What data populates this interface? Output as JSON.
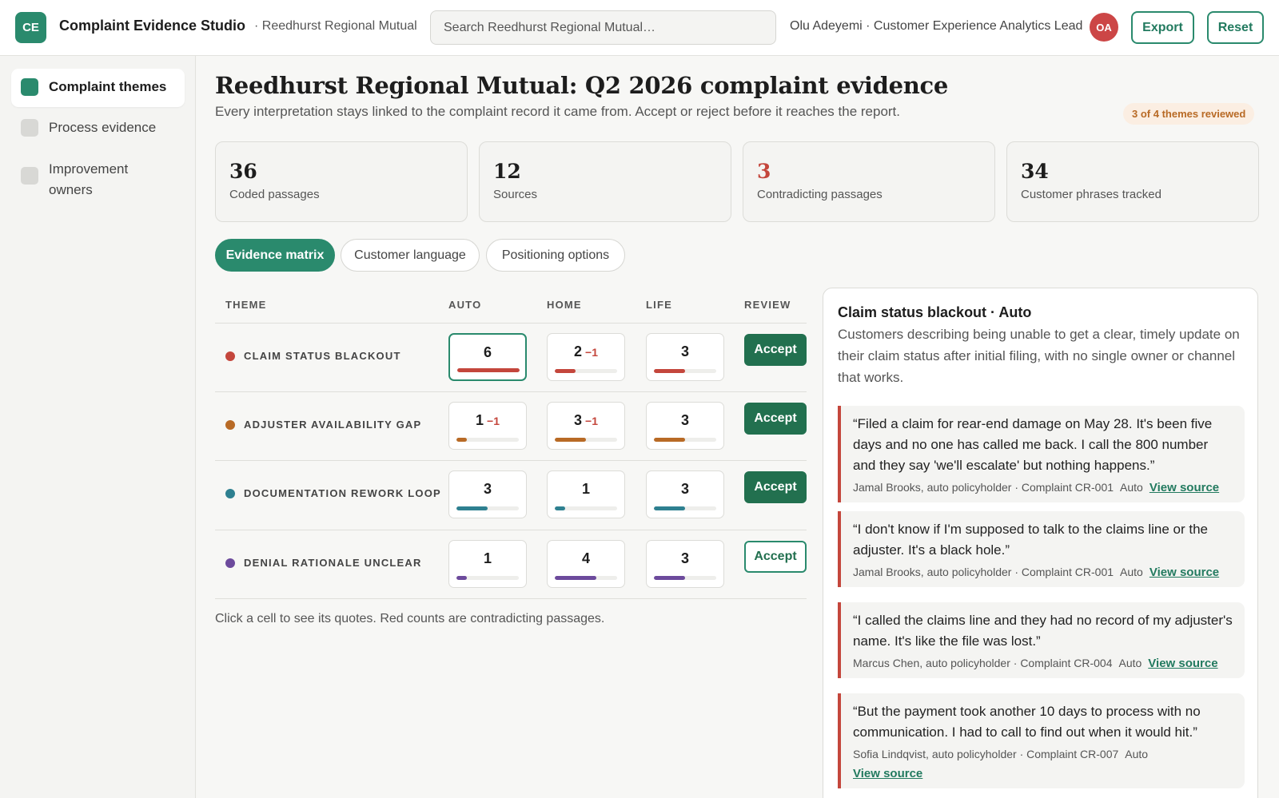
{
  "app": {
    "logo_initials": "CE",
    "title": "Complaint Evidence Studio",
    "org": "· Reedhurst Regional Mutual",
    "search_placeholder": "Search Reedhurst Regional Mutual…",
    "user": "Olu Adeyemi · Customer Experience Analytics Lead",
    "avatar_initials": "OA",
    "export_label": "Export",
    "reset_label": "Reset"
  },
  "sidebar": {
    "items": [
      {
        "label": "Complaint themes",
        "active": true
      },
      {
        "label": "Process evidence",
        "active": false
      },
      {
        "label": "Improvement owners",
        "active": false
      }
    ]
  },
  "main": {
    "title": "Reedhurst Regional Mutual: Q2 2026 complaint evidence",
    "subtitle": "Every interpretation stays linked to the complaint record it came from. Accept or reject before it reaches the report.",
    "review_badge": "3 of 4 themes reviewed",
    "stats": [
      {
        "value": "36",
        "label": "Coded passages"
      },
      {
        "value": "12",
        "label": "Sources"
      },
      {
        "value": "3",
        "label": "Contradicting passages"
      },
      {
        "value": "34",
        "label": "Customer phrases tracked"
      }
    ],
    "tabs": [
      {
        "label": "Evidence matrix"
      },
      {
        "label": "Customer language"
      },
      {
        "label": "Positioning options"
      }
    ]
  },
  "matrix": {
    "headers": [
      "THEME",
      "AUTO",
      "HOME",
      "LIFE",
      "REVIEW"
    ],
    "bar_max": 6,
    "rows": [
      {
        "theme": "CLAIM STATUS BLACKOUT",
        "color": "#c4463c",
        "cells": [
          {
            "count": "6",
            "contradict": "",
            "fill": 6
          },
          {
            "count": "2",
            "contradict": "−1",
            "fill": 2
          },
          {
            "count": "3",
            "contradict": "",
            "fill": 3
          }
        ],
        "accept": "Accept",
        "accepted": true
      },
      {
        "theme": "ADJUSTER AVAILABILITY GAP",
        "color": "#b86a25",
        "cells": [
          {
            "count": "1",
            "contradict": "−1",
            "fill": 1
          },
          {
            "count": "3",
            "contradict": "−1",
            "fill": 3
          },
          {
            "count": "3",
            "contradict": "",
            "fill": 3
          }
        ],
        "accept": "Accept",
        "accepted": true
      },
      {
        "theme": "DOCUMENTATION REWORK LOOP",
        "color": "#2e8090",
        "cells": [
          {
            "count": "3",
            "contradict": "",
            "fill": 3
          },
          {
            "count": "1",
            "contradict": "",
            "fill": 1
          },
          {
            "count": "3",
            "contradict": "",
            "fill": 3
          }
        ],
        "accept": "Accept",
        "accepted": true
      },
      {
        "theme": "DENIAL RATIONALE UNCLEAR",
        "color": "#6c4a9c",
        "cells": [
          {
            "count": "1",
            "contradict": "",
            "fill": 1
          },
          {
            "count": "4",
            "contradict": "",
            "fill": 4
          },
          {
            "count": "3",
            "contradict": "",
            "fill": 3
          }
        ],
        "accept": "Accept",
        "accepted": false
      }
    ],
    "note": "Click a cell to see its quotes. Red counts are contradicting passages."
  },
  "panel": {
    "title": "Claim status blackout · Auto",
    "description": "Customers describing being unable to get a clear, timely update on their claim status after initial filing, with no single owner or channel that works.",
    "quotes": [
      {
        "text": "“Filed a claim for rear-end damage on May 28. It's been five days and no one has called me back. I call the 800 number and they say 'we'll escalate' but nothing happens.”",
        "source": "Jamal Brooks, auto policyholder · Complaint CR-001",
        "line": "Auto",
        "link": "View source"
      },
      {
        "text": "“I don't know if I'm supposed to talk to the claims line or the adjuster. It's a black hole.”",
        "source": "Jamal Brooks, auto policyholder · Complaint CR-001",
        "line": "Auto",
        "link": "View source"
      },
      {
        "text": "“I called the claims line and they had no record of my adjuster's name. It's like the file was lost.”",
        "source": "Marcus Chen, auto policyholder · Complaint CR-004",
        "line": "Auto",
        "link": "View source"
      },
      {
        "text": "“But the payment took another 10 days to process with no communication. I had to call to find out when it would hit.”",
        "source": "Sofia Lindqvist, auto policyholder · Complaint CR-007",
        "line": "Auto",
        "link": "View source"
      }
    ]
  }
}
